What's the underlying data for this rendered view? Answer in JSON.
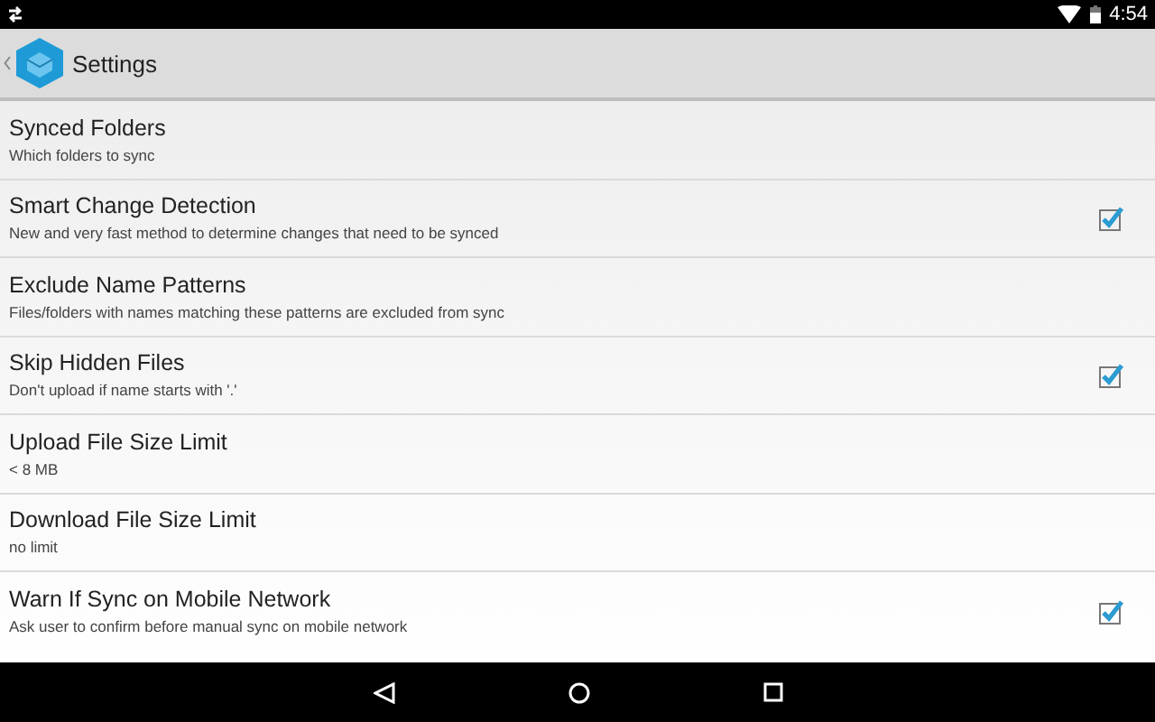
{
  "status_bar": {
    "time": "4:54"
  },
  "action_bar": {
    "title": "Settings"
  },
  "settings": [
    {
      "kind": "link",
      "title": "Synced Folders",
      "summary": "Which folders to sync"
    },
    {
      "kind": "checkbox",
      "title": "Smart Change Detection",
      "summary": "New and very fast method to determine changes that need to be synced",
      "checked": true
    },
    {
      "kind": "link",
      "title": "Exclude Name Patterns",
      "summary": "Files/folders with names matching these patterns are excluded from sync"
    },
    {
      "kind": "checkbox",
      "title": "Skip Hidden Files",
      "summary": "Don't upload if name starts with '.'",
      "checked": true
    },
    {
      "kind": "link",
      "title": "Upload File Size Limit",
      "summary": "< 8 MB"
    },
    {
      "kind": "link",
      "title": "Download File Size Limit",
      "summary": "no limit"
    },
    {
      "kind": "checkbox",
      "title": "Warn If Sync on Mobile Network",
      "summary": "Ask user to confirm before manual sync on mobile network",
      "checked": true
    }
  ]
}
